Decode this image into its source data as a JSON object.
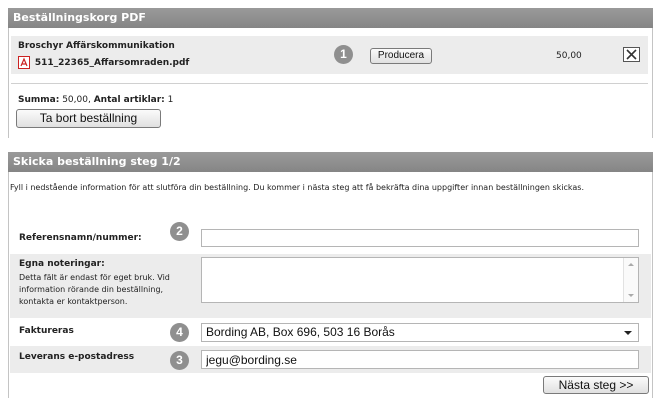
{
  "cart": {
    "title": "Beställningskorg PDF",
    "product_name": "Broschyr Affärskommunikation",
    "file_name": "511_22365_Affarsomraden.pdf",
    "step_number": "1",
    "produce_label": "Producera",
    "price": "50,00",
    "summary_sum_label": "Summa:",
    "summary_sum_value": "50,00,",
    "summary_count_label": "Antal artiklar:",
    "summary_count_value": "1",
    "remove_label": "Ta bort beställning"
  },
  "order": {
    "title": "Skicka beställning steg 1/2",
    "intro": "Fyll i nedstående information för att slutföra din beställning. Du kommer i nästa steg att få bekräfta dina uppgifter innan beställningen skickas.",
    "reference_label": "Referensnamn/nummer:",
    "reference_badge": "2",
    "reference_value": "",
    "notes_label": "Egna noteringar:",
    "notes_help": "Detta fält är endast för eget bruk. Vid information rörande din beställning, kontakta er kontaktperson.",
    "notes_value": "",
    "invoice_label": "Faktureras",
    "invoice_badge": "4",
    "invoice_selected": "Bording AB, Box 696, 503 16 Borås",
    "email_label": "Leverans e-postadress",
    "email_badge": "3",
    "email_value": "jegu@bording.se",
    "next_label": "Nästa steg >>"
  },
  "colors": {
    "header_bg": "#8f8f8f",
    "row_alt_bg": "#ececec",
    "badge_bg": "#8f8f8f",
    "pdf_icon": "#cc2222"
  }
}
